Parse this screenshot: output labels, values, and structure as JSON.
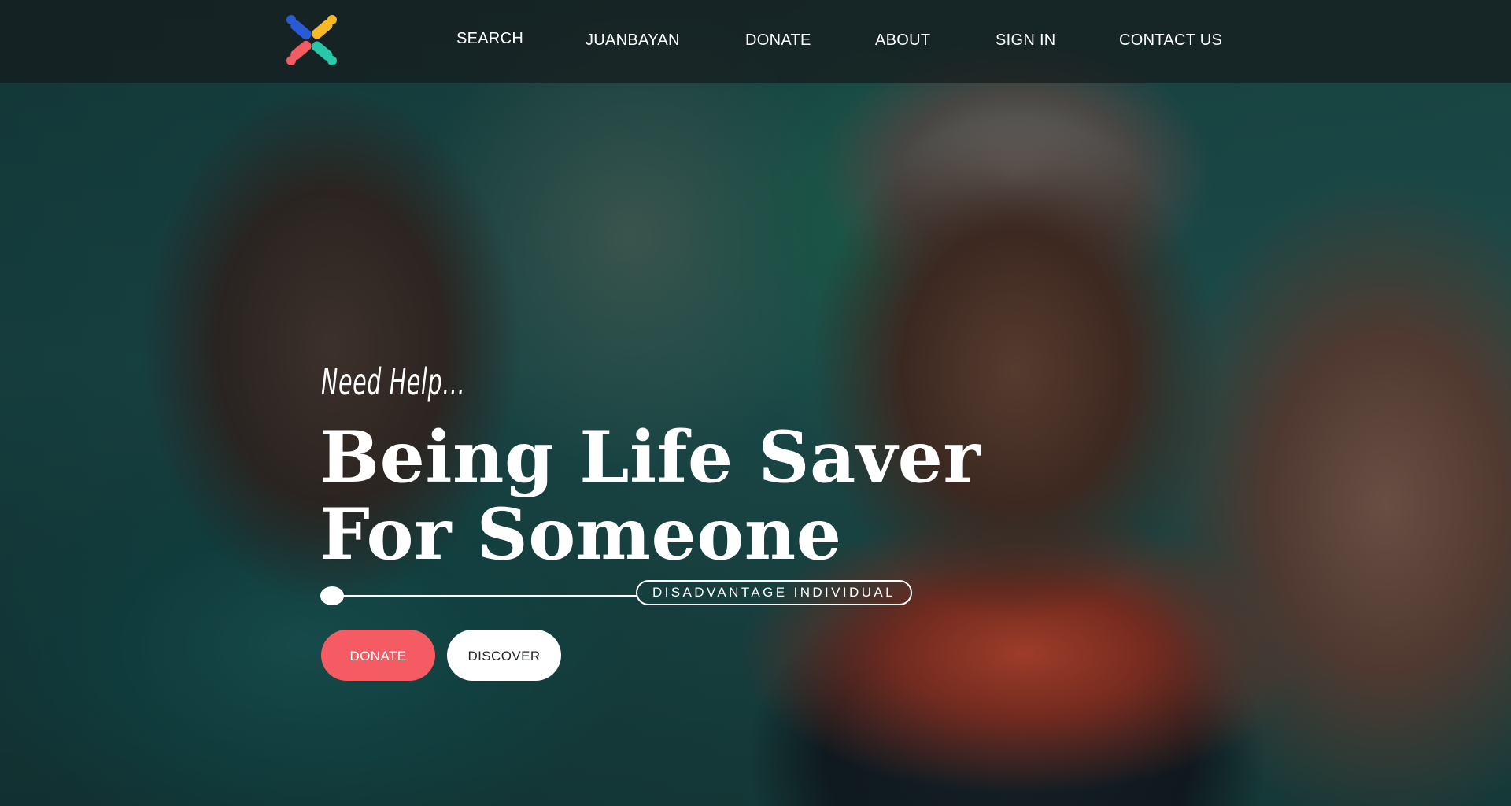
{
  "header": {
    "logo": {
      "icon": "people-puzzle-logo-icon",
      "colors": [
        "#2a5bd7",
        "#f7b928",
        "#f45b62",
        "#27c7a8"
      ]
    },
    "nav": [
      {
        "label": "SEARCH"
      },
      {
        "label": "JUANBAYAN"
      },
      {
        "label": "DONATE"
      },
      {
        "label": "ABOUT"
      },
      {
        "label": "SIGN IN"
      },
      {
        "label": "CONTACT US"
      }
    ]
  },
  "hero": {
    "tagline": "Need Help...",
    "headline_line1": "Being Life Saver",
    "headline_line2": "For Someone",
    "category": "DISADVANTAGE INDIVIDUAL",
    "buttons": {
      "donate": "DONATE",
      "discover": "DISCOVER"
    }
  },
  "colors": {
    "accent": "#f45b62",
    "button_light": "#ffffff",
    "header_bg": "rgba(22,26,28,0.72)"
  }
}
